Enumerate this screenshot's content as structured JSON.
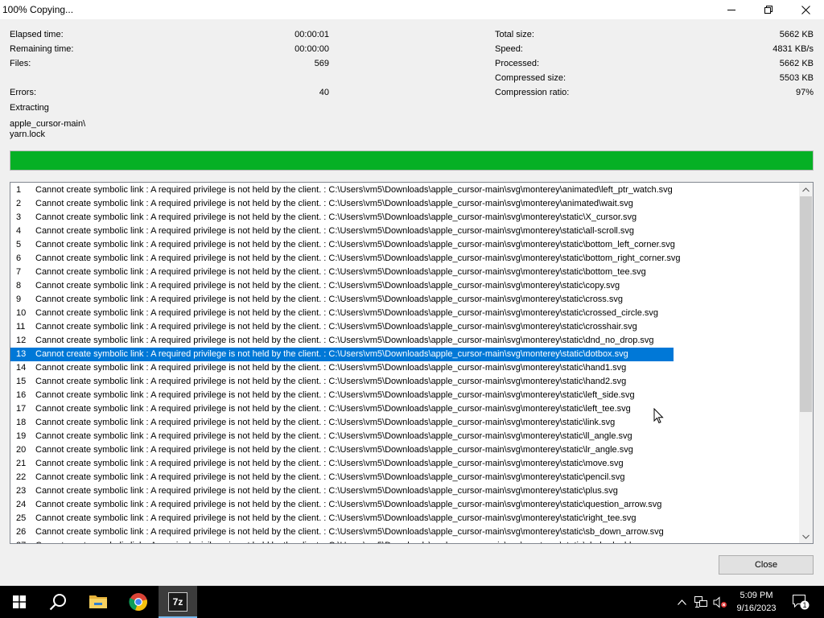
{
  "window": {
    "title": "100% Copying...",
    "controls": {
      "minimize": "minimize-icon",
      "maximize": "restore-icon",
      "close": "close-icon"
    }
  },
  "stats_left": [
    {
      "label": "Elapsed time:",
      "value": "00:00:01"
    },
    {
      "label": "Remaining time:",
      "value": "00:00:00"
    },
    {
      "label": "Files:",
      "value": "569"
    },
    {
      "label": "Errors:",
      "value": "40"
    }
  ],
  "stats_right": [
    {
      "label": "Total size:",
      "value": "5662 KB"
    },
    {
      "label": "Speed:",
      "value": "4831 KB/s"
    },
    {
      "label": "Processed:",
      "value": "5662 KB"
    },
    {
      "label": "Compressed size:",
      "value": "5503 KB"
    },
    {
      "label": "Compression ratio:",
      "value": "97%"
    }
  ],
  "operation": "Extracting",
  "current_path": "apple_cursor-main\\",
  "current_file": "yarn.lock",
  "progress": {
    "percent": 100,
    "color": "#06b025"
  },
  "log": {
    "selected_index": 12,
    "rows": [
      {
        "n": "1",
        "text": "Cannot create symbolic link : A required privilege is not held by the client. : C:\\Users\\vm5\\Downloads\\apple_cursor-main\\svg\\monterey\\animated\\left_ptr_watch.svg"
      },
      {
        "n": "2",
        "text": "Cannot create symbolic link : A required privilege is not held by the client. : C:\\Users\\vm5\\Downloads\\apple_cursor-main\\svg\\monterey\\animated\\wait.svg"
      },
      {
        "n": "3",
        "text": "Cannot create symbolic link : A required privilege is not held by the client. : C:\\Users\\vm5\\Downloads\\apple_cursor-main\\svg\\monterey\\static\\X_cursor.svg"
      },
      {
        "n": "4",
        "text": "Cannot create symbolic link : A required privilege is not held by the client. : C:\\Users\\vm5\\Downloads\\apple_cursor-main\\svg\\monterey\\static\\all-scroll.svg"
      },
      {
        "n": "5",
        "text": "Cannot create symbolic link : A required privilege is not held by the client. : C:\\Users\\vm5\\Downloads\\apple_cursor-main\\svg\\monterey\\static\\bottom_left_corner.svg"
      },
      {
        "n": "6",
        "text": "Cannot create symbolic link : A required privilege is not held by the client. : C:\\Users\\vm5\\Downloads\\apple_cursor-main\\svg\\monterey\\static\\bottom_right_corner.svg"
      },
      {
        "n": "7",
        "text": "Cannot create symbolic link : A required privilege is not held by the client. : C:\\Users\\vm5\\Downloads\\apple_cursor-main\\svg\\monterey\\static\\bottom_tee.svg"
      },
      {
        "n": "8",
        "text": "Cannot create symbolic link : A required privilege is not held by the client. : C:\\Users\\vm5\\Downloads\\apple_cursor-main\\svg\\monterey\\static\\copy.svg"
      },
      {
        "n": "9",
        "text": "Cannot create symbolic link : A required privilege is not held by the client. : C:\\Users\\vm5\\Downloads\\apple_cursor-main\\svg\\monterey\\static\\cross.svg"
      },
      {
        "n": "10",
        "text": "Cannot create symbolic link : A required privilege is not held by the client. : C:\\Users\\vm5\\Downloads\\apple_cursor-main\\svg\\monterey\\static\\crossed_circle.svg"
      },
      {
        "n": "11",
        "text": "Cannot create symbolic link : A required privilege is not held by the client. : C:\\Users\\vm5\\Downloads\\apple_cursor-main\\svg\\monterey\\static\\crosshair.svg"
      },
      {
        "n": "12",
        "text": "Cannot create symbolic link : A required privilege is not held by the client. : C:\\Users\\vm5\\Downloads\\apple_cursor-main\\svg\\monterey\\static\\dnd_no_drop.svg"
      },
      {
        "n": "13",
        "text": "Cannot create symbolic link : A required privilege is not held by the client. : C:\\Users\\vm5\\Downloads\\apple_cursor-main\\svg\\monterey\\static\\dotbox.svg"
      },
      {
        "n": "14",
        "text": "Cannot create symbolic link : A required privilege is not held by the client. : C:\\Users\\vm5\\Downloads\\apple_cursor-main\\svg\\monterey\\static\\hand1.svg"
      },
      {
        "n": "15",
        "text": "Cannot create symbolic link : A required privilege is not held by the client. : C:\\Users\\vm5\\Downloads\\apple_cursor-main\\svg\\monterey\\static\\hand2.svg"
      },
      {
        "n": "16",
        "text": "Cannot create symbolic link : A required privilege is not held by the client. : C:\\Users\\vm5\\Downloads\\apple_cursor-main\\svg\\monterey\\static\\left_side.svg"
      },
      {
        "n": "17",
        "text": "Cannot create symbolic link : A required privilege is not held by the client. : C:\\Users\\vm5\\Downloads\\apple_cursor-main\\svg\\monterey\\static\\left_tee.svg"
      },
      {
        "n": "18",
        "text": "Cannot create symbolic link : A required privilege is not held by the client. : C:\\Users\\vm5\\Downloads\\apple_cursor-main\\svg\\monterey\\static\\link.svg"
      },
      {
        "n": "19",
        "text": "Cannot create symbolic link : A required privilege is not held by the client. : C:\\Users\\vm5\\Downloads\\apple_cursor-main\\svg\\monterey\\static\\ll_angle.svg"
      },
      {
        "n": "20",
        "text": "Cannot create symbolic link : A required privilege is not held by the client. : C:\\Users\\vm5\\Downloads\\apple_cursor-main\\svg\\monterey\\static\\lr_angle.svg"
      },
      {
        "n": "21",
        "text": "Cannot create symbolic link : A required privilege is not held by the client. : C:\\Users\\vm5\\Downloads\\apple_cursor-main\\svg\\monterey\\static\\move.svg"
      },
      {
        "n": "22",
        "text": "Cannot create symbolic link : A required privilege is not held by the client. : C:\\Users\\vm5\\Downloads\\apple_cursor-main\\svg\\monterey\\static\\pencil.svg"
      },
      {
        "n": "23",
        "text": "Cannot create symbolic link : A required privilege is not held by the client. : C:\\Users\\vm5\\Downloads\\apple_cursor-main\\svg\\monterey\\static\\plus.svg"
      },
      {
        "n": "24",
        "text": "Cannot create symbolic link : A required privilege is not held by the client. : C:\\Users\\vm5\\Downloads\\apple_cursor-main\\svg\\monterey\\static\\question_arrow.svg"
      },
      {
        "n": "25",
        "text": "Cannot create symbolic link : A required privilege is not held by the client. : C:\\Users\\vm5\\Downloads\\apple_cursor-main\\svg\\monterey\\static\\right_tee.svg"
      },
      {
        "n": "26",
        "text": "Cannot create symbolic link : A required privilege is not held by the client. : C:\\Users\\vm5\\Downloads\\apple_cursor-main\\svg\\monterey\\static\\sb_down_arrow.svg"
      },
      {
        "n": "27",
        "text": "Cannot create symbolic link : A required privilege is not held by the client. : C:\\Users\\vm5\\Downloads\\apple_cursor-main\\svg\\monterey\\static\\sb_h_double_arrow.svg"
      }
    ]
  },
  "close_button": "Close",
  "taskbar": {
    "items": [
      "windows-start-icon",
      "search-icon",
      "file-explorer-icon",
      "chrome-icon",
      "7zip-icon"
    ],
    "sevenzip_label": "7z",
    "tray": [
      "chevron-up-icon",
      "network-icon",
      "volume-muted-icon"
    ],
    "clock_time": "5:09 PM",
    "clock_date": "9/16/2023",
    "notification_count": "1"
  },
  "colors": {
    "selection": "#0078d7",
    "progress": "#06b025",
    "taskbar": "#000000"
  }
}
